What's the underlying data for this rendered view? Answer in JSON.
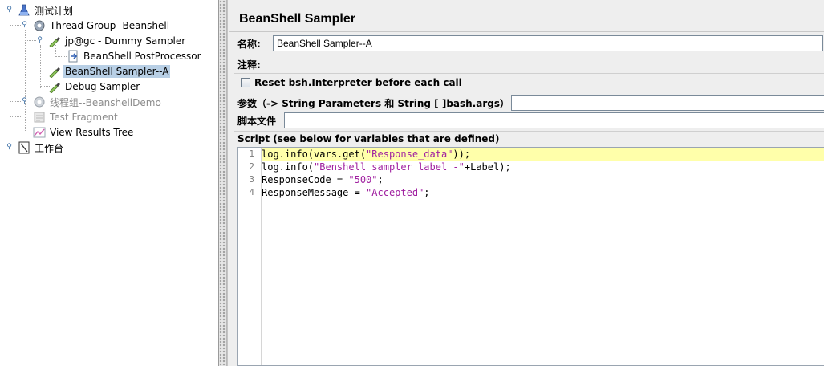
{
  "tree": {
    "root": {
      "label": "测试计划"
    },
    "thread_group": {
      "label": "Thread Group--Beanshell"
    },
    "dummy_sampler": {
      "label": "jp@gc - Dummy Sampler"
    },
    "postprocessor": {
      "label": "BeanShell PostProcessor"
    },
    "beanshell_sampler": {
      "label": "BeanShell Sampler--A"
    },
    "debug_sampler": {
      "label": "Debug Sampler"
    },
    "thread_group_2": {
      "label": "线程组--BeanshellDemo"
    },
    "test_fragment": {
      "label": "Test Fragment"
    },
    "results_tree": {
      "label": "View Results Tree"
    },
    "workbench": {
      "label": "工作台"
    }
  },
  "editor": {
    "title": "BeanShell Sampler",
    "name_label": "名称:",
    "name_value": "BeanShell Sampler--A",
    "comment_label": "注释:",
    "comment_value": "",
    "reset_label": "Reset bsh.Interpreter before each call",
    "reset_checked": false,
    "params_label": "参数（-> String Parameters 和 String [ ]bash.args）",
    "params_value": "",
    "script_file_label": "脚本文件",
    "script_file_value": "",
    "script_label": "Script (see below for variables that are defined)"
  },
  "script": {
    "lines": [
      {
        "no": "1",
        "text": "log.info(vars.get(\"Response_data\"));"
      },
      {
        "no": "2",
        "text": "log.info(\"Benshell sampler label -\"+Label);"
      },
      {
        "no": "3",
        "text": "ResponseCode = \"500\";"
      },
      {
        "no": "4",
        "text": "ResponseMessage = \"Accepted\";"
      }
    ]
  },
  "colors": {
    "selection": "#b8cfe5",
    "current_line": "#ffffaa",
    "string_literal": "#a020a0"
  }
}
